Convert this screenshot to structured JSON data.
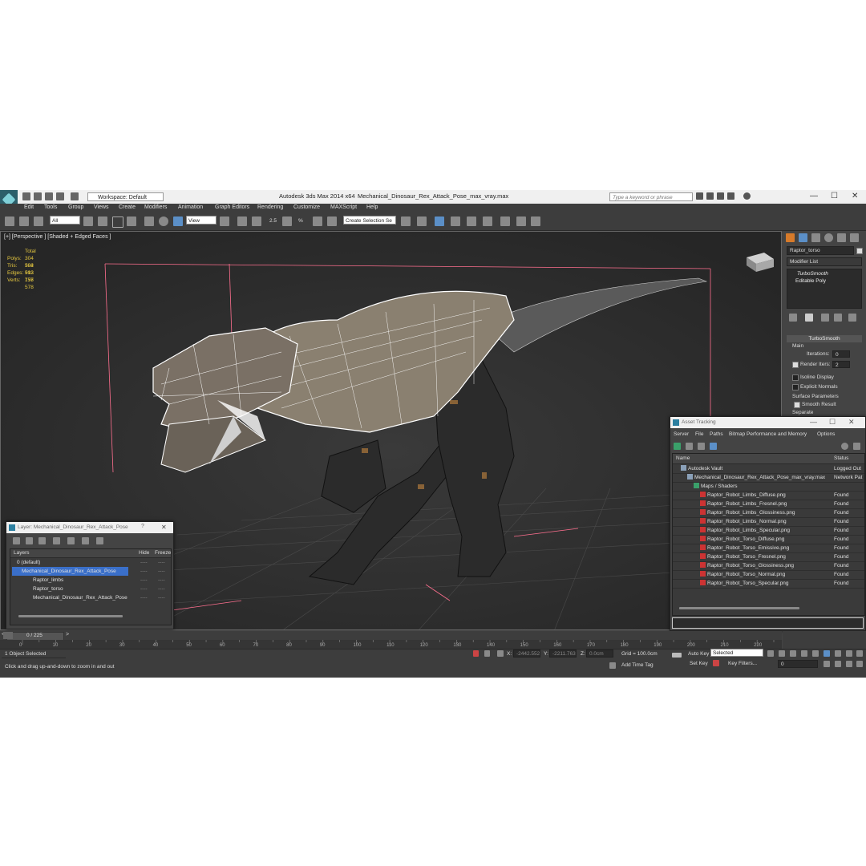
{
  "window": {
    "app_title": "Autodesk 3ds Max  2014 x64",
    "file_title": "Mechanical_Dinosaur_Rex_Attack_Pose_max_vray.max",
    "workspace": "Workspace: Default",
    "search_placeholder": "Type a keyword or phrase",
    "minimize": "—",
    "maximize": "☐",
    "close": "✕"
  },
  "menu": [
    "Edit",
    "Tools",
    "Group",
    "Views",
    "Create",
    "Modifiers",
    "Animation",
    "Graph Editors",
    "Rendering",
    "Customize",
    "MAXScript",
    "Help"
  ],
  "toolbar": {
    "filter": "All",
    "ref_coord": "View",
    "selection_set": "Create Selection Se",
    "snap_labels": [
      "2.5",
      "%"
    ]
  },
  "viewport": {
    "label": "[+] [Perspective ] [Shaded + Edged Faces ]",
    "stats_header": "Total",
    "stats": [
      {
        "label": "Polys:",
        "value": "304 592"
      },
      {
        "label": "Tris:",
        "value": "304 592"
      },
      {
        "label": "Edges:",
        "value": "913 776"
      },
      {
        "label": "Verts:",
        "value": "157 578"
      }
    ]
  },
  "command_panel": {
    "object_name": "Raptor_torso",
    "modifier_list": "Modifier List",
    "stack": [
      "TurboSmooth",
      "Editable Poly"
    ],
    "rollout_title": "TurboSmooth",
    "main_label": "Main",
    "iterations_label": "Iterations:",
    "iterations_value": "0",
    "render_iters_label": "Render Iters:",
    "render_iters_value": "2",
    "isoline": "Isoline Display",
    "explicit": "Explicit Normals",
    "surface_params": "Surface Parameters",
    "smooth_result": "Smooth Result",
    "separate": "Separate"
  },
  "layer_dialog": {
    "title": "Layer: Mechanical_Dinosaur_Rex_Attack_Pose",
    "help": "?",
    "close": "✕",
    "col_layers": "Layers",
    "col_hide": "Hide",
    "col_freeze": "Freeze",
    "rows": [
      {
        "name": "0 (default)",
        "indent": 1,
        "selected": false
      },
      {
        "name": "Mechanical_Dinosaur_Rex_Attack_Pose",
        "indent": 1,
        "selected": true
      },
      {
        "name": "Raptor_limbs",
        "indent": 2,
        "selected": false
      },
      {
        "name": "Raptor_torso",
        "indent": 2,
        "selected": false
      },
      {
        "name": "Mechanical_Dinosaur_Rex_Attack_Pose",
        "indent": 2,
        "selected": false
      }
    ],
    "dash": "----"
  },
  "asset_tracking": {
    "title": "Asset Tracking",
    "menu": [
      "Server",
      "File",
      "Paths",
      "Bitmap Performance and Memory",
      "Options"
    ],
    "col_name": "Name",
    "col_status": "Status",
    "rows": [
      {
        "name": "Autodesk Vault",
        "status": "Logged Out",
        "indent": 1
      },
      {
        "name": "Mechanical_Dinosaur_Rex_Attack_Pose_max_vray.max",
        "status": "Network Pat",
        "indent": 2
      },
      {
        "name": "Maps / Shaders",
        "status": "",
        "indent": 3
      },
      {
        "name": "Raptor_Robot_Limbs_Diffuse.png",
        "status": "Found",
        "indent": 4
      },
      {
        "name": "Raptor_Robot_Limbs_Fresnel.png",
        "status": "Found",
        "indent": 4
      },
      {
        "name": "Raptor_Robot_Limbs_Glossiness.png",
        "status": "Found",
        "indent": 4
      },
      {
        "name": "Raptor_Robot_Limbs_Normal.png",
        "status": "Found",
        "indent": 4
      },
      {
        "name": "Raptor_Robot_Limbs_Specular.png",
        "status": "Found",
        "indent": 4
      },
      {
        "name": "Raptor_Robot_Torso_Diffuse.png",
        "status": "Found",
        "indent": 4
      },
      {
        "name": "Raptor_Robot_Torso_Emissive.png",
        "status": "Found",
        "indent": 4
      },
      {
        "name": "Raptor_Robot_Torso_Fresnel.png",
        "status": "Found",
        "indent": 4
      },
      {
        "name": "Raptor_Robot_Torso_Glossiness.png",
        "status": "Found",
        "indent": 4
      },
      {
        "name": "Raptor_Robot_Torso_Normal.png",
        "status": "Found",
        "indent": 4
      },
      {
        "name": "Raptor_Robot_Torso_Specular.png",
        "status": "Found",
        "indent": 4
      }
    ]
  },
  "timeline": {
    "frame": "0 / 225",
    "ticks": [
      "0",
      "10",
      "20",
      "30",
      "40",
      "50",
      "60",
      "70",
      "80",
      "90",
      "100",
      "110",
      "120",
      "130",
      "140",
      "150",
      "160",
      "170",
      "180",
      "190",
      "200",
      "210",
      "220"
    ]
  },
  "status": {
    "selected": "1 Object Selected",
    "prompt": "Click and drag up-and-down to zoom in and out",
    "x_label": "X:",
    "x_value": "-2442.552",
    "y_label": "Y:",
    "y_value": "-2211.763",
    "z_label": "Z:",
    "z_value": "0.0cm",
    "grid": "Grid = 100.0cm",
    "add_time_tag": "Add Time Tag",
    "auto_key": "Auto Key",
    "set_key": "Set Key",
    "key_mode": "Selected",
    "key_filters": "Key Filters...",
    "current_frame": "0"
  },
  "colors": {
    "selection_blue": "#3a6fc9",
    "stats_yellow": "#e6c840",
    "wire_white": "#ffffff",
    "bbox_pink": "#ff6f8f"
  }
}
